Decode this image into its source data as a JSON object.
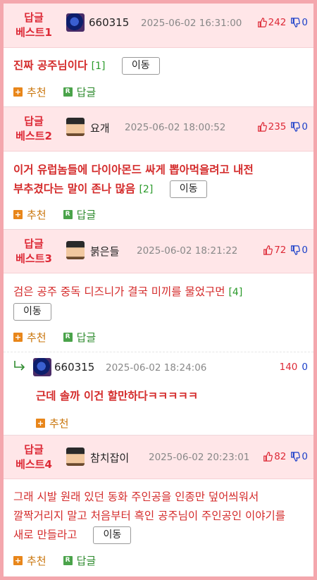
{
  "best_prefix": "베스트",
  "best_label": "답글",
  "move_label": "이동",
  "actions": {
    "recommend": "추천",
    "reply": "답글"
  },
  "posts": [
    {
      "rank": "1",
      "nick": "660315",
      "date": "2025-06-02 16:31:00",
      "up": "242",
      "down": "0",
      "text": "진짜 공주님이다",
      "count": "[1]"
    },
    {
      "rank": "2",
      "nick": "요개",
      "date": "2025-06-02 18:00:52",
      "up": "235",
      "down": "0",
      "text": "이거 유럽놈들에 다이아몬드 싸게 뽑아먹을려고 내전 부추겼다는 말이 존나 많음",
      "count": "[2]"
    },
    {
      "rank": "3",
      "nick": "붉은들",
      "date": "2025-06-02 18:21:22",
      "up": "72",
      "down": "0",
      "text": "검은 공주 중독 디즈니가 결국 미끼를 물었구먼",
      "count": "[4]"
    },
    {
      "rank": "4",
      "nick": "참치잡이",
      "date": "2025-06-02 20:23:01",
      "up": "82",
      "down": "0",
      "text": "그래 시발 원래 있던 동화 주인공을 인종만 덮어씌워서 깔짝거리지 말고 처음부터 흑인 공주님이 주인공인 이야기를 새로 만들라고",
      "count": ""
    }
  ],
  "reply": {
    "nick": "660315",
    "date": "2025-06-02 18:24:06",
    "up": "140",
    "down": "0",
    "text": "근데 솔까 이건 할만하다ㅋㅋㅋㅋㅋ"
  },
  "colors": {
    "accent": "#dd2a37",
    "header_bg": "#ffe6e8",
    "frame": "#f4a7ad",
    "down_vote": "#1a3fc9",
    "count": "#2a9a2a",
    "recommend": "#e8861a"
  }
}
